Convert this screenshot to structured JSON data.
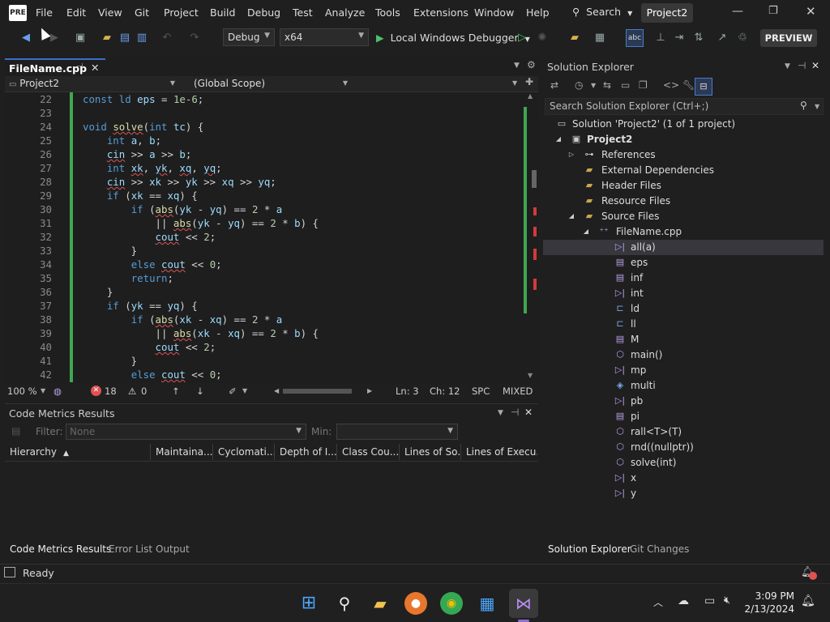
{
  "menu": [
    "File",
    "Edit",
    "View",
    "Git",
    "Project",
    "Build",
    "Debug",
    "Test",
    "Analyze",
    "Tools",
    "Extensions",
    "Window",
    "Help"
  ],
  "search_label": "Search",
  "solution_title": "Project2",
  "toolbar": {
    "config": "Debug",
    "platform": "x64",
    "run_label": "Local Windows Debugger",
    "preview": "PREVIEW"
  },
  "editor": {
    "tab": "FileName.cpp",
    "project_combo": "Project2",
    "scope_combo": "(Global Scope)",
    "lines": [
      {
        "n": "22"
      },
      {
        "n": "23"
      },
      {
        "n": "24"
      },
      {
        "n": "25"
      },
      {
        "n": "26"
      },
      {
        "n": "27"
      },
      {
        "n": "28"
      },
      {
        "n": "29"
      },
      {
        "n": "30"
      },
      {
        "n": "31"
      },
      {
        "n": "32"
      },
      {
        "n": "33"
      },
      {
        "n": "34"
      },
      {
        "n": "35"
      },
      {
        "n": "36"
      },
      {
        "n": "37"
      },
      {
        "n": "38"
      },
      {
        "n": "39"
      },
      {
        "n": "40"
      },
      {
        "n": "41"
      },
      {
        "n": "42"
      }
    ],
    "zoom": "100 %",
    "errors": "18",
    "warnings": "0",
    "ln": "Ln: 3",
    "ch": "Ch: 12",
    "spc": "SPC",
    "eol": "MIXED"
  },
  "metrics": {
    "title": "Code Metrics Results",
    "filter_label": "Filter:",
    "filter_value": "None",
    "min_label": "Min:",
    "columns": [
      "Hierarchy",
      "Maintaina...",
      "Cyclomati...",
      "Depth of I...",
      "Class Cou...",
      "Lines of So...",
      "Lines of Execu..."
    ]
  },
  "bottom_tabs": [
    "Code Metrics Results",
    "Error List",
    "Output"
  ],
  "solution_explorer": {
    "title": "Solution Explorer",
    "search_placeholder": "Search Solution Explorer (Ctrl+;)",
    "items": [
      {
        "label": "Solution 'Project2' (1 of 1 project)",
        "icon": "solution-icon"
      },
      {
        "label": "Project2",
        "icon": "project-icon"
      },
      {
        "label": "References",
        "icon": "references-icon"
      },
      {
        "label": "External Dependencies",
        "icon": "folder-icon"
      },
      {
        "label": "Header Files",
        "icon": "folder-icon"
      },
      {
        "label": "Resource Files",
        "icon": "folder-icon"
      },
      {
        "label": "Source Files",
        "icon": "folder-icon"
      },
      {
        "label": "FileName.cpp",
        "icon": "cpp-file-icon"
      },
      {
        "label": "all(a)",
        "icon": "macro-icon"
      },
      {
        "label": "eps",
        "icon": "variable-icon"
      },
      {
        "label": "inf",
        "icon": "variable-icon"
      },
      {
        "label": "int",
        "icon": "macro-icon"
      },
      {
        "label": "ld",
        "icon": "typedef-icon"
      },
      {
        "label": "ll",
        "icon": "macro-icon"
      },
      {
        "label": "M",
        "icon": "variable-icon"
      },
      {
        "label": "main()",
        "icon": "method-icon"
      },
      {
        "label": "mp",
        "icon": "macro-icon"
      },
      {
        "label": "multi",
        "icon": "struct-icon"
      },
      {
        "label": "pb",
        "icon": "macro-icon"
      },
      {
        "label": "pi",
        "icon": "variable-icon"
      },
      {
        "label": "rall<T>(T)",
        "icon": "method-icon"
      },
      {
        "label": "rnd((nullptr))",
        "icon": "method-icon"
      },
      {
        "label": "solve(int)",
        "icon": "method-icon"
      },
      {
        "label": "x",
        "icon": "macro-icon"
      },
      {
        "label": "y",
        "icon": "macro-icon"
      }
    ]
  },
  "side_tabs": [
    "Solution Explorer",
    "Git Changes"
  ],
  "status": {
    "text": "Ready"
  },
  "clock": {
    "time": "3:09 PM",
    "date": "2/13/2024"
  },
  "colors": {
    "accent": "#3c6ec8",
    "vs_purple": "#8f6fd6",
    "error": "#e05252"
  }
}
